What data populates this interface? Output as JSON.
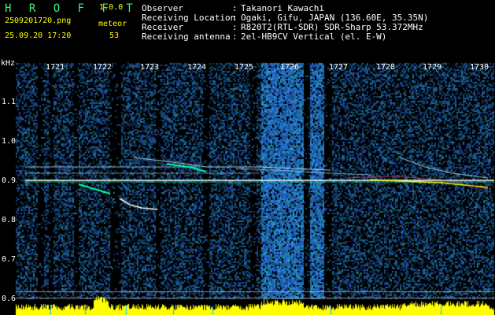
{
  "header": {
    "app_title": "H R O F F T",
    "version": "1.0.0",
    "filename": "2509201720.png",
    "datetime": "25.09.20 17:20",
    "meteor_label": "meteor",
    "meteor_count": "53"
  },
  "info": {
    "rows": [
      {
        "label": "Observer",
        "sep": ":",
        "value": "Takanori Kawachi"
      },
      {
        "label": "Receiving Location",
        "sep": ":",
        "value": "Ogaki, Gifu, JAPAN (136.60E, 35.35N)"
      },
      {
        "label": "Receiver",
        "sep": ":",
        "value": "R820T2(RTL-SDR) SDR-Sharp 53.372MHz"
      },
      {
        "label": "Receiving antenna",
        "sep": ":",
        "value": "2el-HB9CV Vertical (el. E-W)"
      }
    ]
  },
  "spectrogram": {
    "unit_label": "kHz",
    "y_ticks": [
      "1.1",
      "1.0",
      "0.9",
      "0.8",
      "0.7",
      "0.6"
    ],
    "x_ticks": [
      "1721",
      "1722",
      "1723",
      "1724",
      "1725",
      "1726",
      "1727",
      "1728",
      "1729",
      "1730"
    ],
    "colors": {
      "background": "#000000",
      "noise": "#1a3c96",
      "signal_hot": "#ffff00",
      "signal_warm": "#00ffb0",
      "signal_carrier": "#ffffff",
      "level_bars": "#ffff00",
      "level_lines": "#00c8ff"
    }
  }
}
